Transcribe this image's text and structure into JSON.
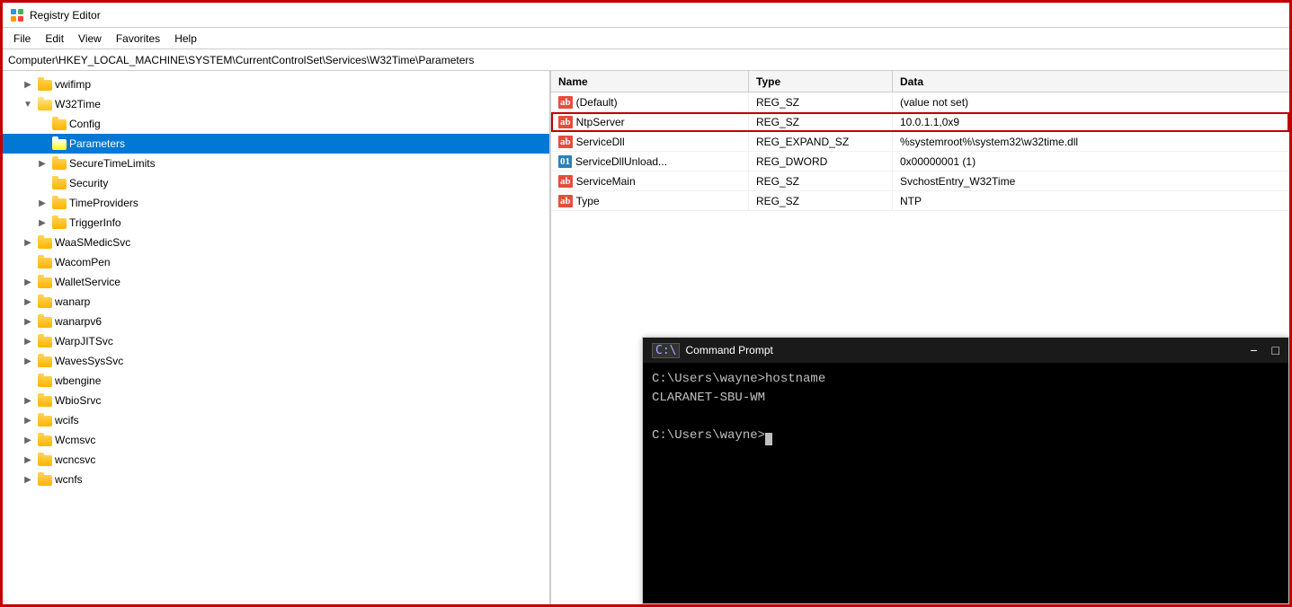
{
  "window": {
    "title": "Registry Editor",
    "border_color": "#c00000"
  },
  "menu": {
    "items": [
      "File",
      "Edit",
      "View",
      "Favorites",
      "Help"
    ]
  },
  "address_bar": {
    "path": "Computer\\HKEY_LOCAL_MACHINE\\SYSTEM\\CurrentControlSet\\Services\\W32Time\\Parameters"
  },
  "tree": {
    "items": [
      {
        "id": "vwifimp",
        "label": "vwifimp",
        "indent": 1,
        "expanded": false,
        "type": "collapsed"
      },
      {
        "id": "w32time",
        "label": "W32Time",
        "indent": 1,
        "expanded": true,
        "type": "expanded"
      },
      {
        "id": "config",
        "label": "Config",
        "indent": 2,
        "expanded": false,
        "type": "leaf"
      },
      {
        "id": "parameters",
        "label": "Parameters",
        "indent": 2,
        "expanded": false,
        "type": "leaf",
        "selected": true
      },
      {
        "id": "securetimelimits",
        "label": "SecureTimeLimits",
        "indent": 2,
        "expanded": false,
        "type": "collapsed"
      },
      {
        "id": "security",
        "label": "Security",
        "indent": 2,
        "expanded": false,
        "type": "leaf"
      },
      {
        "id": "timeproviders",
        "label": "TimeProviders",
        "indent": 2,
        "expanded": false,
        "type": "collapsed"
      },
      {
        "id": "triggerinfo",
        "label": "TriggerInfo",
        "indent": 2,
        "expanded": false,
        "type": "collapsed"
      },
      {
        "id": "waasmedicsvc",
        "label": "WaaSMedicSvc",
        "indent": 1,
        "expanded": false,
        "type": "collapsed"
      },
      {
        "id": "wacompen",
        "label": "WacomPen",
        "indent": 1,
        "expanded": false,
        "type": "leaf"
      },
      {
        "id": "walletservice",
        "label": "WalletService",
        "indent": 1,
        "expanded": false,
        "type": "collapsed"
      },
      {
        "id": "wanarp",
        "label": "wanarp",
        "indent": 1,
        "expanded": false,
        "type": "collapsed"
      },
      {
        "id": "wanarpv6",
        "label": "wanarpv6",
        "indent": 1,
        "expanded": false,
        "type": "collapsed"
      },
      {
        "id": "warpjitsvc",
        "label": "WarpJITSvc",
        "indent": 1,
        "expanded": false,
        "type": "collapsed"
      },
      {
        "id": "wavesyssvc",
        "label": "WavesSysSvc",
        "indent": 1,
        "expanded": false,
        "type": "collapsed"
      },
      {
        "id": "wbengine",
        "label": "wbengine",
        "indent": 1,
        "expanded": false,
        "type": "leaf"
      },
      {
        "id": "wbiosrvc",
        "label": "WbioSrvc",
        "indent": 1,
        "expanded": false,
        "type": "collapsed"
      },
      {
        "id": "wcifs",
        "label": "wcifs",
        "indent": 1,
        "expanded": false,
        "type": "collapsed"
      },
      {
        "id": "wcmsvc",
        "label": "Wcmsvc",
        "indent": 1,
        "expanded": false,
        "type": "collapsed"
      },
      {
        "id": "wcncsvc",
        "label": "wcncsvc",
        "indent": 1,
        "expanded": false,
        "type": "collapsed"
      },
      {
        "id": "wcnfs",
        "label": "wcnfs",
        "indent": 1,
        "expanded": false,
        "type": "collapsed"
      }
    ]
  },
  "values": {
    "columns": [
      "Name",
      "Type",
      "Data"
    ],
    "rows": [
      {
        "name": "(Default)",
        "type": "REG_SZ",
        "data": "(value not set)",
        "icon": "ab",
        "highlighted": false
      },
      {
        "name": "NtpServer",
        "type": "REG_SZ",
        "data": "10.0.1.1,0x9",
        "icon": "ab",
        "highlighted": true
      },
      {
        "name": "ServiceDll",
        "type": "REG_EXPAND_SZ",
        "data": "%systemroot%\\system32\\w32time.dll",
        "icon": "ab",
        "highlighted": false
      },
      {
        "name": "ServiceDllUnload...",
        "type": "REG_DWORD",
        "data": "0x00000001 (1)",
        "icon": "dw",
        "highlighted": false
      },
      {
        "name": "ServiceMain",
        "type": "REG_SZ",
        "data": "SvchostEntry_W32Time",
        "icon": "ab",
        "highlighted": false
      },
      {
        "name": "Type",
        "type": "REG_SZ",
        "data": "NTP",
        "icon": "ab",
        "highlighted": false
      }
    ]
  },
  "cmd_window": {
    "title": "Command Prompt",
    "lines": [
      "C:\\Users\\wayne>hostname",
      "CLARANET-SBU-WM",
      "",
      "C:\\Users\\wayne>"
    ]
  }
}
